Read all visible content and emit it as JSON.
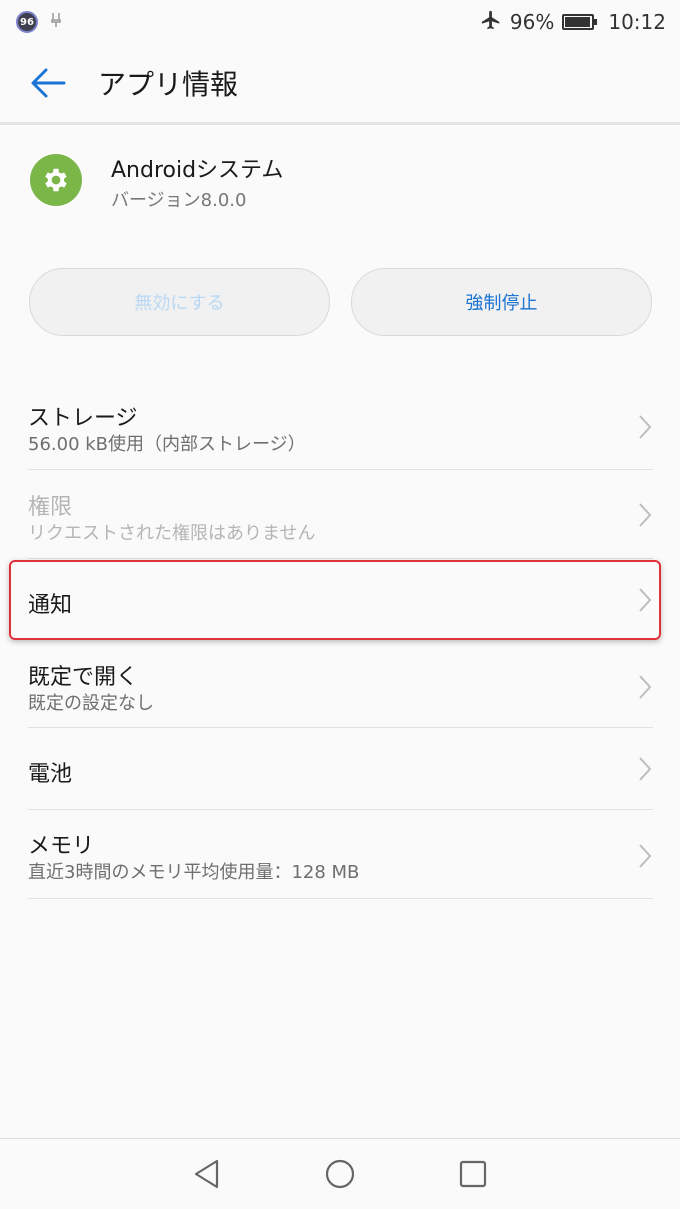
{
  "status_bar": {
    "notification_count": "96",
    "battery_percent": "96%",
    "battery_level": 0.96,
    "time": "10:12",
    "icons": [
      "notification-badge-icon",
      "usb-debug-icon",
      "airplane-icon",
      "battery-icon"
    ]
  },
  "app_bar": {
    "title": "アプリ情報",
    "back_icon": "arrow-left-icon"
  },
  "app": {
    "name": "Androidシステム",
    "version": "バージョン8.0.0",
    "icon": "gear-icon",
    "icon_color": "#7ab648"
  },
  "buttons": {
    "disable_label": "無効にする",
    "force_stop_label": "強制停止"
  },
  "list": [
    {
      "title": "ストレージ",
      "subtitle": "56.00 kB使用（内部ストレージ）",
      "enabled": true
    },
    {
      "title": "権限",
      "subtitle": "リクエストされた権限はありません",
      "enabled": false
    },
    {
      "title": "通知",
      "subtitle": "",
      "enabled": true,
      "highlighted": true
    },
    {
      "title": "既定で開く",
      "subtitle": "既定の設定なし",
      "enabled": true
    },
    {
      "title": "電池",
      "subtitle": "",
      "enabled": true
    },
    {
      "title": "メモリ",
      "subtitle": "直近3時間のメモリ平均使用量：128 MB",
      "enabled": true
    }
  ],
  "nav_bar": {
    "icons": [
      "back-triangle-icon",
      "home-circle-icon",
      "recents-square-icon"
    ]
  },
  "colors": {
    "accent": "#1b73d4",
    "highlight": "#e0313a",
    "disabled_text": "#b9d8f3"
  }
}
